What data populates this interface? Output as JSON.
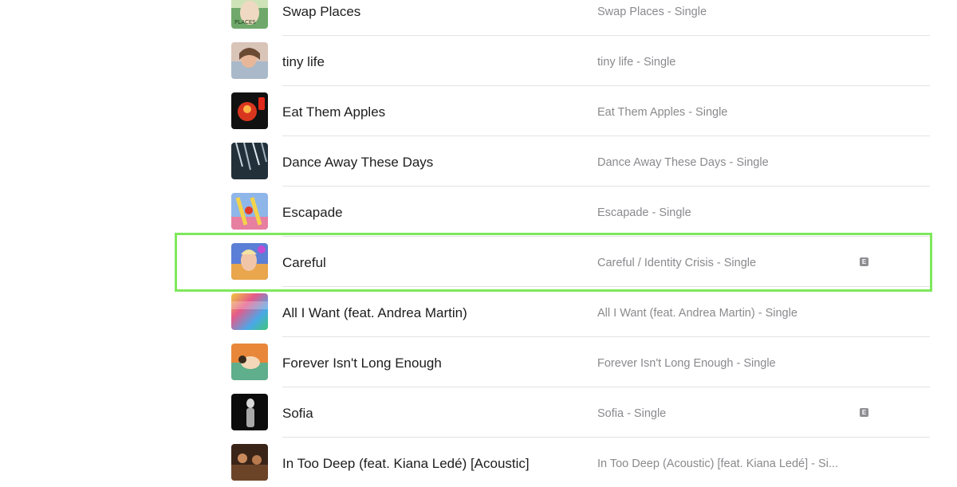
{
  "tracks": [
    {
      "title": "Swap Places",
      "album": "Swap Places - Single",
      "explicit": false,
      "art": "swap-places-art"
    },
    {
      "title": "tiny life",
      "album": "tiny life - Single",
      "explicit": false,
      "art": "tiny-life-art"
    },
    {
      "title": "Eat Them Apples",
      "album": "Eat Them Apples - Single",
      "explicit": false,
      "art": "eat-them-apples-art"
    },
    {
      "title": "Dance Away These Days",
      "album": "Dance Away These Days - Single",
      "explicit": false,
      "art": "dance-away-art"
    },
    {
      "title": "Escapade",
      "album": "Escapade - Single",
      "explicit": false,
      "art": "escapade-art"
    },
    {
      "title": "Careful",
      "album": "Careful / Identity Crisis - Single",
      "explicit": true,
      "art": "careful-art"
    },
    {
      "title": "All I Want (feat. Andrea Martin)",
      "album": "All I Want (feat. Andrea Martin) - Single",
      "explicit": false,
      "art": "all-i-want-art"
    },
    {
      "title": "Forever Isn't Long Enough",
      "album": "Forever Isn't Long Enough - Single",
      "explicit": false,
      "art": "forever-art"
    },
    {
      "title": "Sofia",
      "album": "Sofia - Single",
      "explicit": true,
      "art": "sofia-art"
    },
    {
      "title": "In Too Deep (feat. Kiana Ledé) [Acoustic]",
      "album": "In Too Deep (Acoustic) [feat. Kiana Ledé] - Si...",
      "explicit": false,
      "art": "in-too-deep-art"
    }
  ],
  "explicit_badge": "E",
  "highlighted_track": "Careful",
  "colors": {
    "highlight": "#7ee85c",
    "title_text": "#1d1d1f",
    "album_text": "#8a8a8e",
    "divider": "#e3e3e5"
  }
}
